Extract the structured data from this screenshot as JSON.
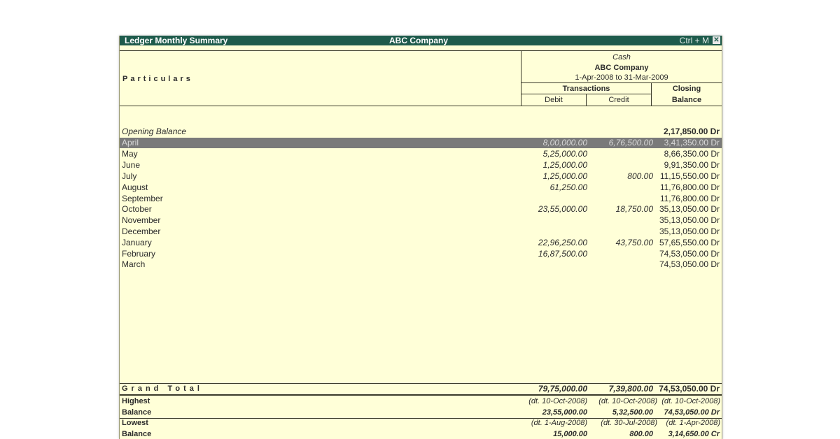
{
  "window": {
    "title": "Ledger Monthly Summary",
    "company": "ABC Company",
    "shortcut": "Ctrl + M",
    "close_glyph": "✕"
  },
  "header": {
    "particulars": "Particulars",
    "ledger": "Cash",
    "company": "ABC Company",
    "period": "1-Apr-2008 to 31-Mar-2009",
    "transactions": "Transactions",
    "debit": "Debit",
    "credit": "Credit",
    "closing": "Closing",
    "balance": "Balance"
  },
  "opening": {
    "label": "Opening Balance",
    "balance": "2,17,850.00 Dr"
  },
  "rows": [
    {
      "month": "April",
      "debit": "8,00,000.00",
      "credit": "6,76,500.00",
      "balance": "3,41,350.00 Dr"
    },
    {
      "month": "May",
      "debit": "5,25,000.00",
      "credit": "",
      "balance": "8,66,350.00 Dr"
    },
    {
      "month": "June",
      "debit": "1,25,000.00",
      "credit": "",
      "balance": "9,91,350.00 Dr"
    },
    {
      "month": "July",
      "debit": "1,25,000.00",
      "credit": "800.00",
      "balance": "11,15,550.00 Dr"
    },
    {
      "month": "August",
      "debit": "61,250.00",
      "credit": "",
      "balance": "11,76,800.00 Dr"
    },
    {
      "month": "September",
      "debit": "",
      "credit": "",
      "balance": "11,76,800.00 Dr"
    },
    {
      "month": "October",
      "debit": "23,55,000.00",
      "credit": "18,750.00",
      "balance": "35,13,050.00 Dr"
    },
    {
      "month": "November",
      "debit": "",
      "credit": "",
      "balance": "35,13,050.00 Dr"
    },
    {
      "month": "December",
      "debit": "",
      "credit": "",
      "balance": "35,13,050.00 Dr"
    },
    {
      "month": "January",
      "debit": "22,96,250.00",
      "credit": "43,750.00",
      "balance": "57,65,550.00 Dr"
    },
    {
      "month": "February",
      "debit": "16,87,500.00",
      "credit": "",
      "balance": "74,53,050.00 Dr"
    },
    {
      "month": "March",
      "debit": "",
      "credit": "",
      "balance": "74,53,050.00 Dr"
    }
  ],
  "grand_total": {
    "label": "Grand Total",
    "debit": "79,75,000.00",
    "credit": "7,39,800.00",
    "balance": "74,53,050.00 Dr"
  },
  "highest": {
    "label": "Highest",
    "debit_date": "(dt. 10-Oct-2008)",
    "credit_date": "(dt. 10-Oct-2008)",
    "balance_date": "(dt. 10-Oct-2008)",
    "value_label": "Balance",
    "debit": "23,55,000.00",
    "credit": "5,32,500.00",
    "balance": "74,53,050.00 Dr"
  },
  "lowest": {
    "label": "Lowest",
    "debit_date": "(dt. 1-Aug-2008)",
    "credit_date": "(dt. 30-Jul-2008)",
    "balance_date": "(dt. 1-Apr-2008)",
    "value_label": "Balance",
    "debit": "15,000.00",
    "credit": "800.00",
    "balance": "3,14,650.00 Cr"
  }
}
